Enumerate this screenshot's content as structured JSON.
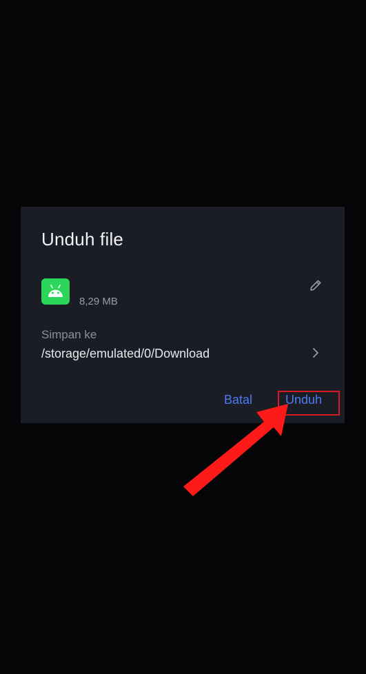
{
  "dialog": {
    "title": "Unduh file",
    "file_size": "8,29 MB",
    "save_label": "Simpan ke",
    "save_path": "/storage/emulated/0/Download",
    "cancel_label": "Batal",
    "download_label": "Unduh"
  },
  "icons": {
    "app": "android-icon",
    "edit": "pencil-icon",
    "path": "chevron-right-icon"
  },
  "colors": {
    "accent": "#4d7cf0",
    "app_icon": "#2bd65a",
    "highlight": "#d81b23",
    "arrow": "#ff1a1a"
  }
}
